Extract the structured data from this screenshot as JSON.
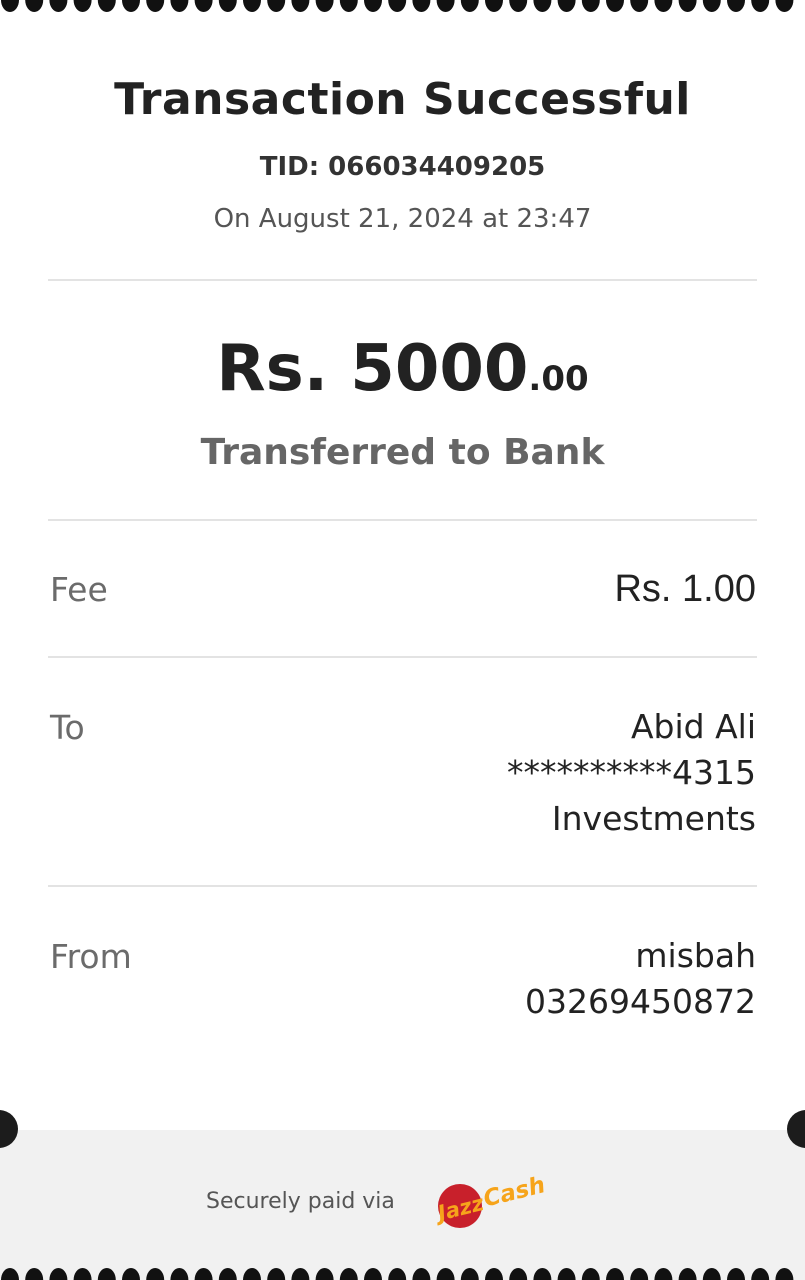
{
  "header": {
    "title": "Transaction Successful",
    "tid": "TID: 066034409205",
    "date": "On August 21, 2024 at 23:47"
  },
  "amount": {
    "main": "Rs. 5000",
    "cents": ".00",
    "label": "Transferred to Bank"
  },
  "fee": {
    "label": "Fee",
    "value": "Rs. 1.00"
  },
  "to": {
    "label": "To",
    "name": "Abid Ali",
    "account": "**********4315",
    "bank": "Investments"
  },
  "from": {
    "label": "From",
    "name": "misbah",
    "number": "03269450872"
  },
  "footer": {
    "text": "Securely paid via",
    "logo_text": "JazzCash",
    "logo_icon": "jazzcash-logo"
  },
  "colors": {
    "title": "#222222",
    "muted": "#6b6b6b",
    "divider": "#e3e3e3",
    "footer_bg": "#f1f1f1",
    "logo_red": "#c8202b",
    "logo_orange": "#f6a41b"
  }
}
